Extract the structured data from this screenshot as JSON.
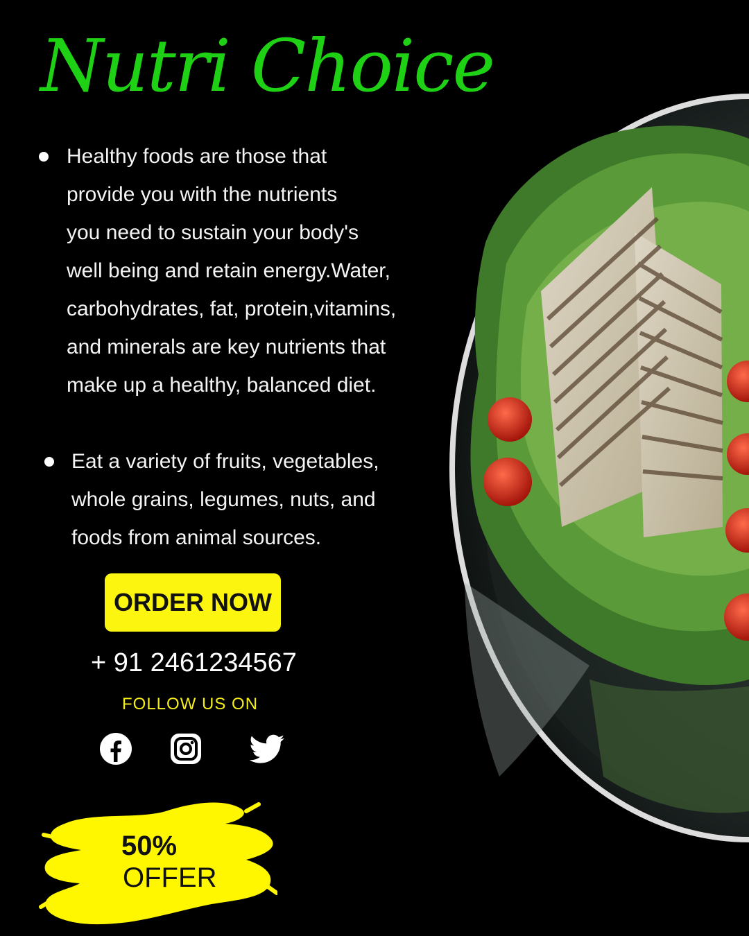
{
  "brand": "Nutri Choice",
  "bullets": [
    {
      "lines": [
        "Healthy foods are those that",
        "provide you with the nutrients",
        "you need to sustain your body's",
        "well being and retain energy.Water,",
        "carbohydrates, fat, protein,vitamins,",
        "and minerals are key nutrients that",
        "make up a healthy, balanced diet."
      ]
    },
    {
      "lines": [
        "Eat a variety of fruits, vegetables,",
        "whole grains, legumes, nuts, and",
        "foods from animal sources."
      ]
    }
  ],
  "order_button": "ORDER NOW",
  "phone": "+ 91 2461234567",
  "follow_label": "FOLLOW US ON",
  "social_icons": [
    "facebook-icon",
    "instagram-icon",
    "twitter-icon"
  ],
  "offer": {
    "percent": "50%",
    "label": "OFFER"
  },
  "colors": {
    "brand": "#1fd114",
    "accent_yellow": "#fcf50f",
    "background": "#000000"
  }
}
